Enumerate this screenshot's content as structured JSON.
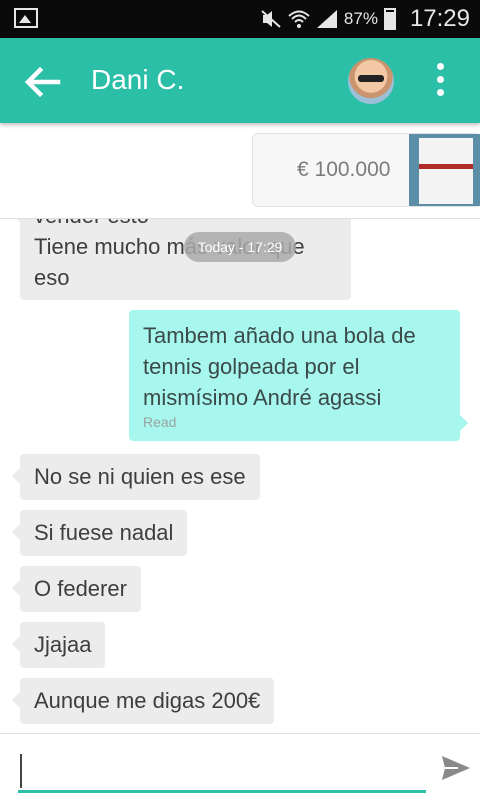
{
  "status_bar": {
    "battery": "87%",
    "time": "17:29"
  },
  "header": {
    "contact_name": "Dani C."
  },
  "listing": {
    "price": "€ 100.000"
  },
  "chat": {
    "date_divider": "Today - 17:29",
    "first_message": {
      "line1": "vender esto",
      "line2": "Tiene mucho más valor que",
      "line3": "eso"
    },
    "sent_message": {
      "line1": "Tambem añado una bola de",
      "line2": "tennis golpeada por el",
      "line3": "mismísimo André agassi",
      "status": "Read"
    },
    "received": [
      "No se ni quien es ese",
      "Si fuese nadal",
      "O federer",
      "Jjajaa",
      "Aunque me digas 200€"
    ]
  },
  "composer": {
    "placeholder": ""
  }
}
